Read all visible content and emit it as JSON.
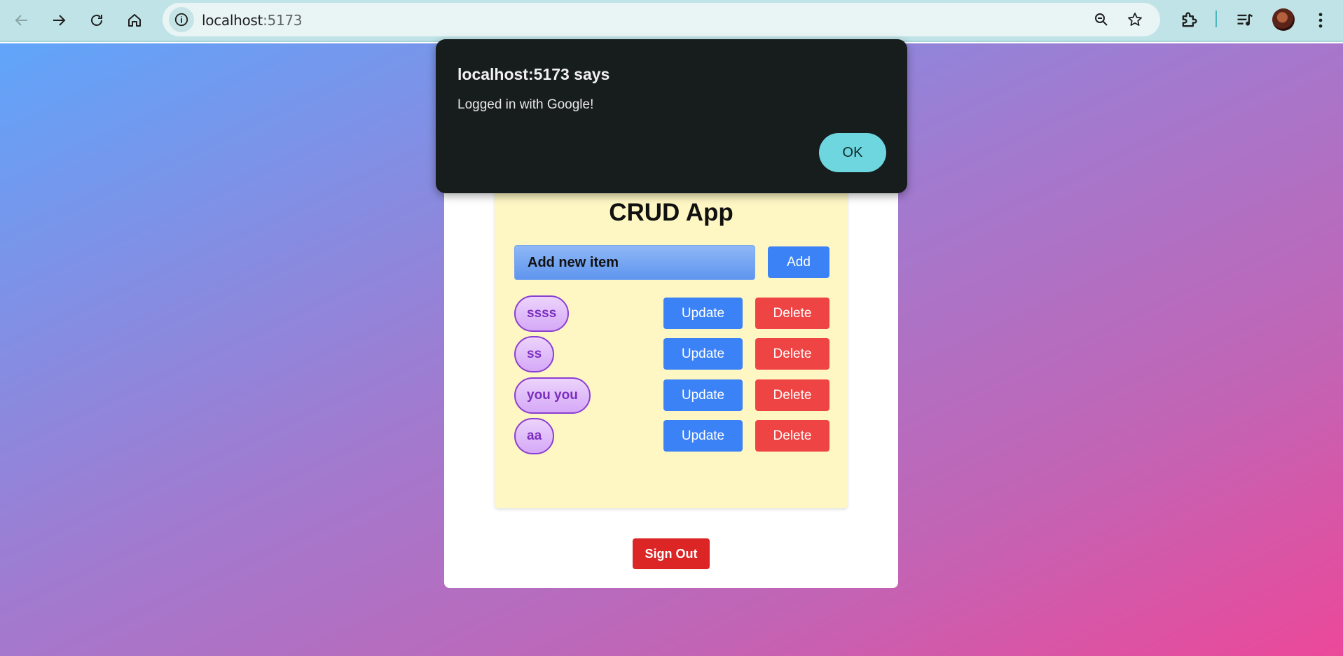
{
  "browser": {
    "url_host": "localhost",
    "url_port": ":5173",
    "icons": [
      "back-icon",
      "forward-icon",
      "reload-icon",
      "home-icon",
      "site-info-icon",
      "zoom-icon",
      "star-icon",
      "extensions-icon",
      "media-icon",
      "profile-avatar",
      "menu-icon"
    ]
  },
  "app": {
    "title": "CRUD App",
    "input_placeholder": "Add new item",
    "add_label": "Add",
    "items": [
      {
        "text": "ssss",
        "update_label": "Update",
        "delete_label": "Delete"
      },
      {
        "text": "ss",
        "update_label": "Update",
        "delete_label": "Delete"
      },
      {
        "text": "you you",
        "update_label": "Update",
        "delete_label": "Delete"
      },
      {
        "text": "aa",
        "update_label": "Update",
        "delete_label": "Delete"
      }
    ],
    "signout_label": "Sign Out"
  },
  "dialog": {
    "title": "localhost:5173 says",
    "message": "Logged in with Google!",
    "ok_label": "OK"
  },
  "colors": {
    "accent_blue": "#3b82f6",
    "danger_red": "#ef4444",
    "signout_red": "#dc2626",
    "ok_button": "#6dd6df",
    "dialog_bg": "#171d1d"
  }
}
